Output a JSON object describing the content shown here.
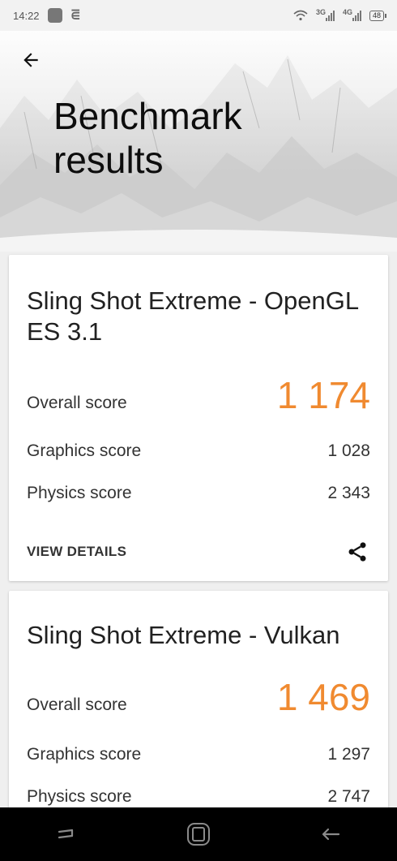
{
  "status_bar": {
    "time": "14:22",
    "network_1": "3G",
    "network_2": "4G",
    "battery": "48"
  },
  "header": {
    "title": "Benchmark results",
    "back_icon": "arrow-left-icon"
  },
  "results": [
    {
      "title": "Sling Shot Extreme - OpenGL ES 3.1",
      "overall_label": "Overall score",
      "overall_value": "1 174",
      "graphics_label": "Graphics score",
      "graphics_value": "1 028",
      "physics_label": "Physics score",
      "physics_value": "2 343",
      "details_label": "VIEW DETAILS",
      "share_icon": "share-icon"
    },
    {
      "title": "Sling Shot Extreme - Vulkan",
      "overall_label": "Overall score",
      "overall_value": "1 469",
      "graphics_label": "Graphics score",
      "graphics_value": "1 297",
      "physics_label": "Physics score",
      "physics_value": "2 747"
    }
  ],
  "nav_bar": {
    "recents_icon": "recents-icon",
    "home_icon": "home-icon",
    "back_icon": "back-icon"
  },
  "colors": {
    "accent": "#f08a30",
    "nav_bar": "#000000",
    "card": "#ffffff"
  }
}
